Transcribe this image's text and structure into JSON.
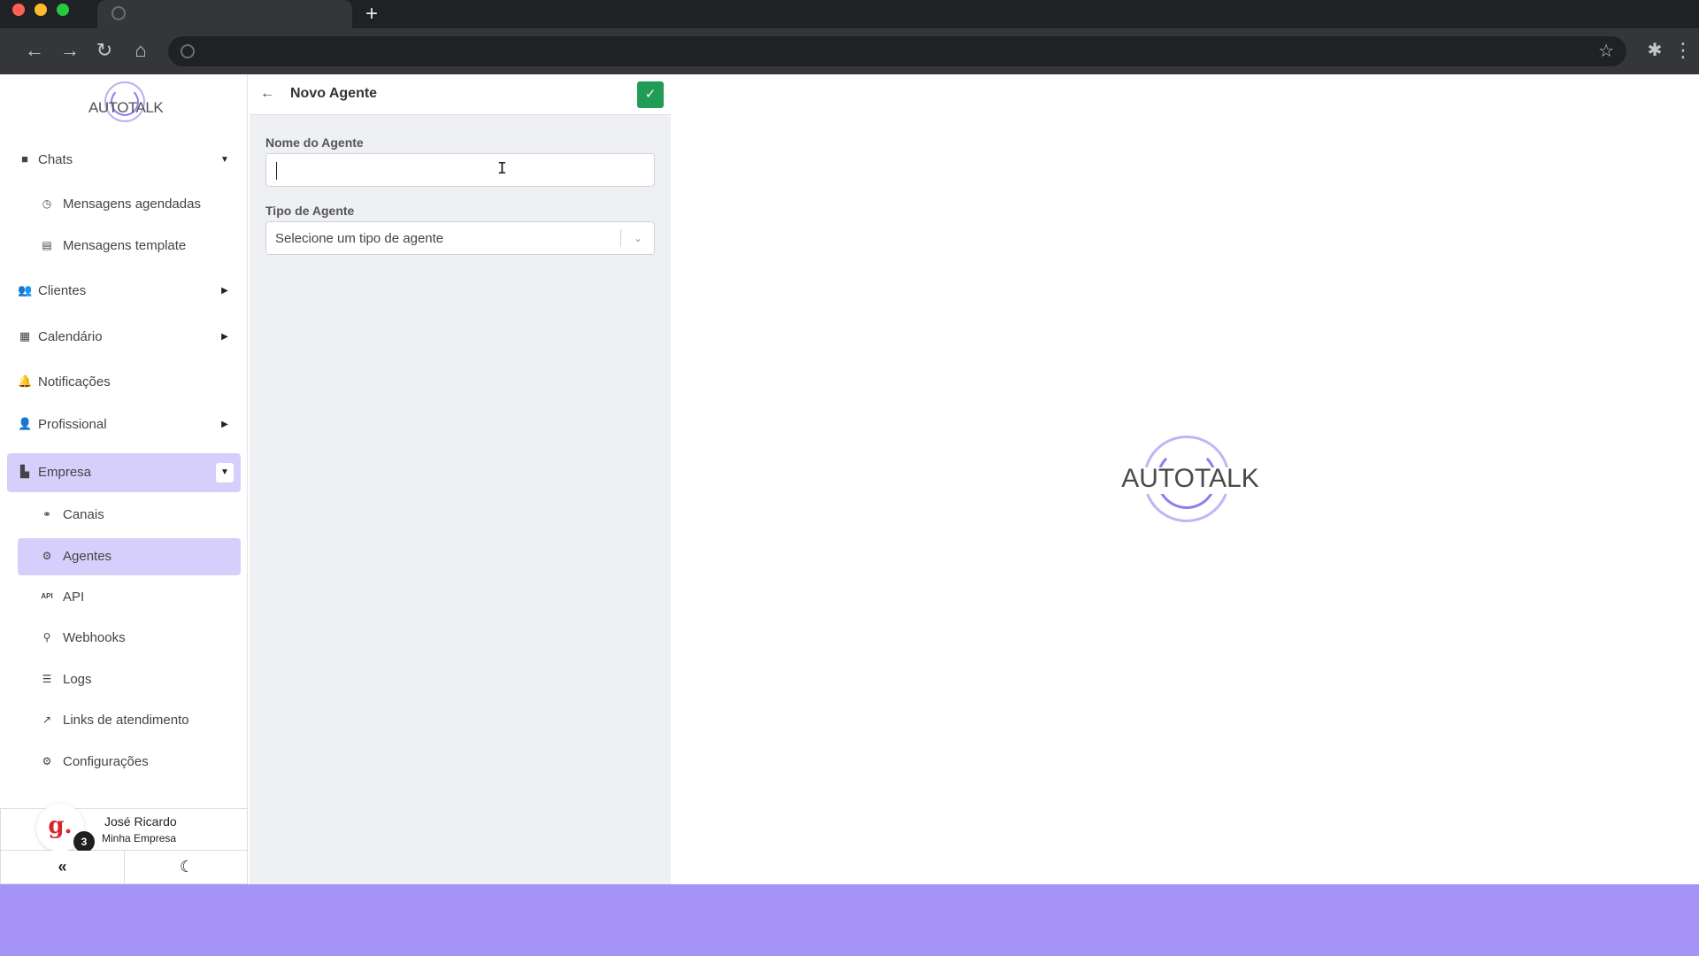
{
  "browser": {
    "new_tab_label": "+"
  },
  "brand": {
    "logo_text": "AUTOTALK",
    "accent_color": "#a593f7"
  },
  "sidebar": {
    "items": [
      {
        "label": "Chats",
        "icon": "chat-icon",
        "caret": "▼"
      },
      {
        "label": "Mensagens agendadas",
        "icon": "clock-icon"
      },
      {
        "label": "Mensagens template",
        "icon": "template-icon"
      },
      {
        "label": "Clientes",
        "icon": "users-icon",
        "caret": "▶"
      },
      {
        "label": "Calendário",
        "icon": "calendar-icon",
        "caret": "▶"
      },
      {
        "label": "Notificações",
        "icon": "bell-icon"
      },
      {
        "label": "Profissional",
        "icon": "user-gear-icon",
        "caret": "▶"
      },
      {
        "label": "Empresa",
        "icon": "building-icon",
        "caret": "▼"
      },
      {
        "label": "Canais",
        "icon": "link-icon"
      },
      {
        "label": "Agentes",
        "icon": "robot-icon"
      },
      {
        "label": "API",
        "icon": "api-icon"
      },
      {
        "label": "Webhooks",
        "icon": "webhook-icon"
      },
      {
        "label": "Logs",
        "icon": "list-icon"
      },
      {
        "label": "Links de atendimento",
        "icon": "external-link-icon"
      },
      {
        "label": "Configurações",
        "icon": "gear-icon"
      }
    ]
  },
  "user": {
    "avatar_letter": "g.",
    "notifications": "3",
    "name": "José Ricardo",
    "company": "Minha Empresa"
  },
  "footer": {
    "collapse_label": "«",
    "theme_label": "☾"
  },
  "form": {
    "title": "Novo Agente",
    "name_label": "Nome do Agente",
    "name_value": "",
    "type_label": "Tipo de Agente",
    "type_placeholder": "Selecione um tipo de agente"
  }
}
